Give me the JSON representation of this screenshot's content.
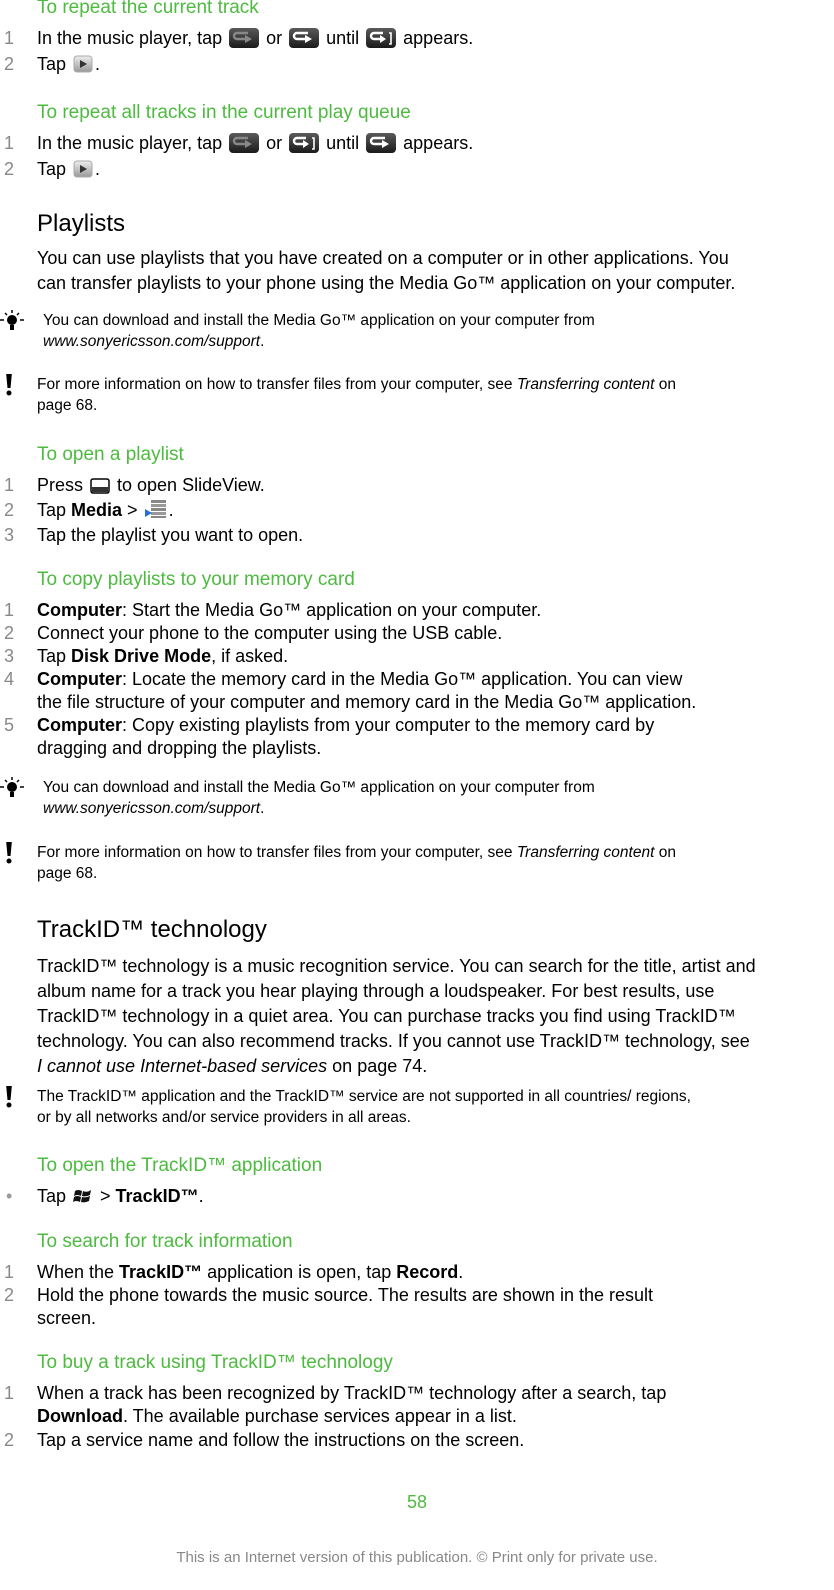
{
  "sections": {
    "repeat_current": {
      "heading": "To repeat the current track",
      "step1": {
        "num": "1",
        "a": "In the music player, tap ",
        "b": " or ",
        "c": " until ",
        "d": " appears."
      },
      "step2": {
        "num": "2",
        "a": "Tap ",
        "b": "."
      }
    },
    "repeat_all": {
      "heading": "To repeat all tracks in the current play queue",
      "step1": {
        "num": "1",
        "a": "In the music player, tap ",
        "b": " or ",
        "c": " until ",
        "d": " appears."
      },
      "step2": {
        "num": "2",
        "a": "Tap ",
        "b": "."
      }
    },
    "playlists": {
      "heading": "Playlists",
      "para_line1": "You can use playlists that you have created on a computer or in other applications. You",
      "para_line2": "can transfer playlists to your phone using the Media Go™ application on your computer.",
      "tip": {
        "line1": "You can download and install the Media Go™ application on your computer from",
        "link": "www.sonyericsson.com/support",
        "end": "."
      },
      "note": {
        "line1_a": "For more information on how to transfer files from your computer, see ",
        "line1_link": "Transferring content",
        "line1_b": " on",
        "line2": "page 68."
      }
    },
    "open_playlist": {
      "heading": "To open a playlist",
      "step1": {
        "num": "1",
        "a": "Press ",
        "b": " to open SlideView."
      },
      "step2": {
        "num": "2",
        "a": "Tap ",
        "bold": "Media",
        "b": " > ",
        "c": "."
      },
      "step3": {
        "num": "3",
        "a": "Tap the playlist you want to open."
      }
    },
    "copy_playlists": {
      "heading": "To copy playlists to your memory card",
      "step1": {
        "num": "1",
        "bold": "Computer",
        "a": ": Start the Media Go™ application on your computer."
      },
      "step2": {
        "num": "2",
        "a": "Connect your phone to the computer using the USB cable."
      },
      "step3": {
        "num": "3",
        "a": "Tap ",
        "bold": "Disk Drive Mode",
        "b": ", if asked."
      },
      "step4": {
        "num": "4",
        "bold": "Computer",
        "a": ": Locate the memory card in the Media Go™ application. You can view",
        "line2": "the file structure of your computer and memory card in the Media Go™ application."
      },
      "step5": {
        "num": "5",
        "bold": "Computer",
        "a": ": Copy existing playlists from your computer to the memory card by",
        "line2": "dragging and dropping the playlists."
      },
      "tip": {
        "line1": "You can download and install the Media Go™ application on your computer from",
        "link": "www.sonyericsson.com/support",
        "end": "."
      },
      "note": {
        "line1_a": "For more information on how to transfer files from your computer, see ",
        "line1_link": "Transferring content",
        "line1_b": " on",
        "line2": "page 68."
      }
    },
    "trackid": {
      "heading": "TrackID™ technology",
      "para_lines": [
        "TrackID™ technology is a music recognition service. You can search for the title, artist and",
        "album name for a track you hear playing through a loudspeaker. For best results, use",
        "TrackID™ technology in a quiet area. You can purchase tracks you find using TrackID™",
        "technology. You can also recommend tracks. If you cannot use TrackID™ technology, see"
      ],
      "para_last_link": "I cannot use Internet-based services",
      "para_last_end": " on page 74.",
      "note": {
        "line1": "The TrackID™ application and the TrackID™ service are not supported in all countries/ regions,",
        "line2": "or by all networks and/or service providers in all areas."
      }
    },
    "open_trackid": {
      "heading": "To open the TrackID™ application",
      "bullet": "•",
      "step": {
        "a": "Tap ",
        "b": " > ",
        "bold": "TrackID™",
        "c": "."
      }
    },
    "search_track": {
      "heading": "To search for track information",
      "step1": {
        "num": "1",
        "a": "When the ",
        "bold1": "TrackID™",
        "b": " application is open, tap ",
        "bold2": "Record",
        "c": "."
      },
      "step2": {
        "num": "2",
        "a": "Hold the phone towards the music source. The results are shown in the result",
        "line2": "screen."
      }
    },
    "buy_track": {
      "heading": "To buy a track using TrackID™ technology",
      "step1": {
        "num": "1",
        "a": "When a track has been recognized by TrackID™ technology after a search, tap",
        "bold": "Download",
        "b": ". The available purchase services appear in a list."
      },
      "step2": {
        "num": "2",
        "a": "Tap a service name and follow the instructions on the screen."
      }
    }
  },
  "icons": {
    "repeat_off": "repeat-off-icon",
    "repeat_all": "repeat-all-icon",
    "repeat_one": "repeat-one-icon",
    "play": "play-icon",
    "slideview_key": "slideview-key-icon",
    "playlist": "playlist-icon",
    "start": "start-menu-icon",
    "tip": "lightbulb-icon",
    "note": "exclamation-icon"
  },
  "footer": {
    "page_number": "58",
    "notice": "This is an Internet version of this publication. © Print only for private use."
  },
  "colors": {
    "heading_green": "#4dbb3f",
    "step_number_gray": "#888888"
  }
}
